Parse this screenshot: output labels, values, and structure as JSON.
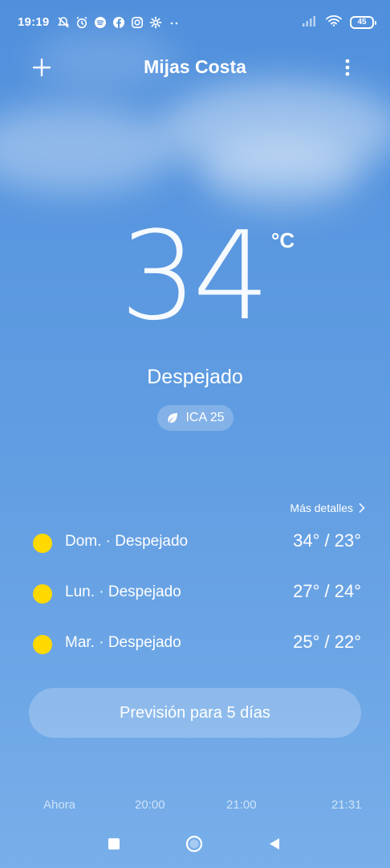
{
  "status_bar": {
    "time": "19:19",
    "battery": "45",
    "left_icons": [
      "notifications-off-icon",
      "alarm-icon",
      "spotify-icon",
      "facebook-icon",
      "instagram-icon",
      "settings-icon",
      "more-dots-icon"
    ],
    "right_icons": [
      "signal-icon",
      "wifi-icon",
      "battery-icon"
    ]
  },
  "header": {
    "city": "Mijas Costa",
    "add_icon": "plus-icon",
    "menu_icon": "more-vertical-icon"
  },
  "current": {
    "temperature": "34",
    "unit": "°C",
    "condition": "Despejado",
    "aqi_label": "ICA 25",
    "aqi_icon": "leaf-icon"
  },
  "forecast": {
    "more_details": "Más detalles",
    "days": [
      {
        "label": "Dom. · Despejado",
        "temps": "34° / 23°",
        "icon": "sun-icon"
      },
      {
        "label": "Lun. · Despejado",
        "temps": "27° / 24°",
        "icon": "sun-icon"
      },
      {
        "label": "Mar. · Despejado",
        "temps": "25° / 22°",
        "icon": "sun-icon"
      }
    ],
    "five_day_button": "Previsión para 5 días"
  },
  "hourly": {
    "times": [
      "Ahora",
      "20:00",
      "21:00",
      "21:31"
    ]
  },
  "colors": {
    "sky_top": "#4f8fdc",
    "sky_bottom": "#78afea",
    "sun": "#ffd900",
    "text": "#ffffff"
  }
}
